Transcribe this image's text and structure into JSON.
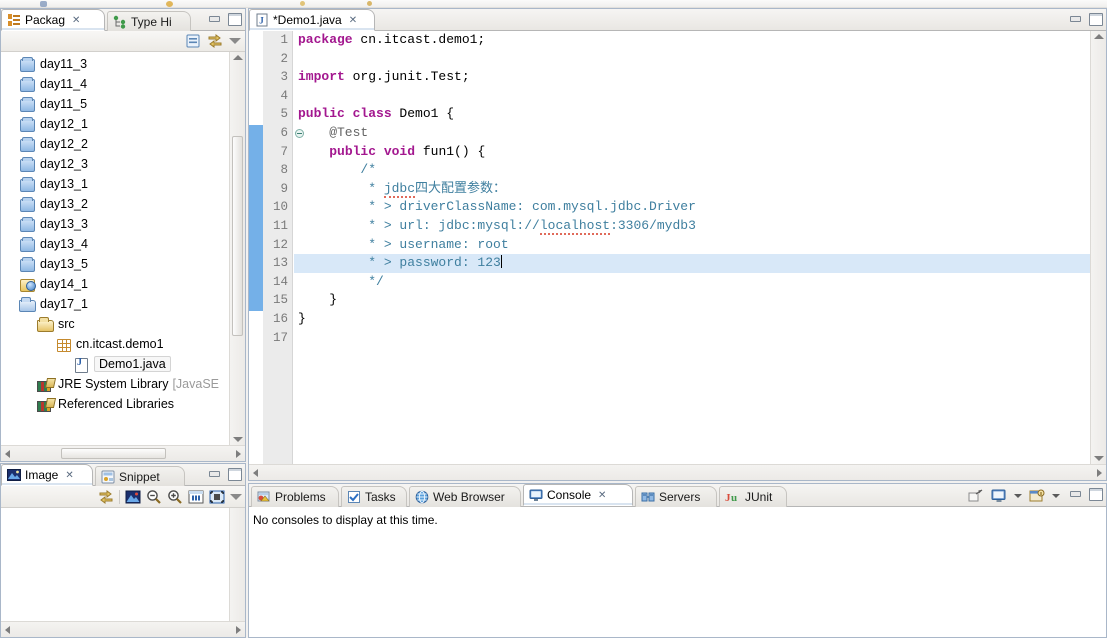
{
  "toolbar": {
    "dots": [
      "#7b93b8",
      "#d9a227",
      "#d9b34f",
      "#cfa23b"
    ]
  },
  "package_explorer": {
    "tabs": [
      {
        "label": "Packag",
        "icon": "package-explorer-icon",
        "active": true,
        "closable": true
      },
      {
        "label": "Type Hi",
        "icon": "type-hierarchy-icon",
        "active": false,
        "closable": false
      }
    ],
    "toolbar_icons": [
      "collapse-all-icon",
      "link-with-editor-icon",
      "view-menu-icon"
    ],
    "window_buttons": [
      "minimize",
      "maximize"
    ],
    "tree": [
      {
        "label": "day11_3",
        "icon": "project",
        "indent": 0,
        "selected": false
      },
      {
        "label": "day11_4",
        "icon": "project",
        "indent": 0,
        "selected": false
      },
      {
        "label": "day11_5",
        "icon": "project",
        "indent": 0,
        "selected": false
      },
      {
        "label": "day12_1",
        "icon": "project",
        "indent": 0,
        "selected": false
      },
      {
        "label": "day12_2",
        "icon": "project",
        "indent": 0,
        "selected": false
      },
      {
        "label": "day12_3",
        "icon": "project",
        "indent": 0,
        "selected": false
      },
      {
        "label": "day13_1",
        "icon": "project",
        "indent": 0,
        "selected": false
      },
      {
        "label": "day13_2",
        "icon": "project",
        "indent": 0,
        "selected": false
      },
      {
        "label": "day13_3",
        "icon": "project",
        "indent": 0,
        "selected": false
      },
      {
        "label": "day13_4",
        "icon": "project",
        "indent": 0,
        "selected": false
      },
      {
        "label": "day13_5",
        "icon": "project",
        "indent": 0,
        "selected": false
      },
      {
        "label": "day14_1",
        "icon": "project-web",
        "indent": 0,
        "selected": false
      },
      {
        "label": "day17_1",
        "icon": "project-open",
        "indent": 0,
        "selected": false
      },
      {
        "label": "src",
        "icon": "source-folder",
        "indent": 1,
        "selected": false
      },
      {
        "label": "cn.itcast.demo1",
        "icon": "package",
        "indent": 2,
        "selected": false
      },
      {
        "label": "Demo1.java",
        "icon": "java-file",
        "indent": 3,
        "selected": true
      },
      {
        "label": "JRE System Library",
        "suffix": "[JavaSE",
        "icon": "library",
        "indent": 1,
        "selected": false
      },
      {
        "label": "Referenced Libraries",
        "icon": "library",
        "indent": 1,
        "selected": false
      }
    ]
  },
  "image_view": {
    "tabs": [
      {
        "label": "Image",
        "icon": "image-icon",
        "active": true,
        "closable": true
      },
      {
        "label": "Snippet",
        "icon": "snippet-icon",
        "active": false,
        "closable": false
      }
    ],
    "toolbar_icons": [
      "refresh-icon",
      "image-icon",
      "zoom-out-icon",
      "zoom-in-icon",
      "fit-width-icon",
      "fit-page-icon",
      "view-menu-icon"
    ],
    "window_buttons": [
      "minimize",
      "maximize"
    ]
  },
  "editor": {
    "tab": {
      "label": "*Demo1.java",
      "icon": "java-file-icon",
      "closable": true,
      "dirty": true
    },
    "window_buttons": [
      "minimize",
      "maximize"
    ],
    "current_line": 13,
    "fold_marker_line": 6,
    "block_indicator": {
      "from_line": 6,
      "to_line": 15
    },
    "lines": [
      {
        "n": 1,
        "tokens": [
          {
            "t": "package",
            "c": "kw"
          },
          {
            "t": " cn.itcast.demo1;",
            "c": ""
          }
        ]
      },
      {
        "n": 2,
        "tokens": []
      },
      {
        "n": 3,
        "tokens": [
          {
            "t": "import",
            "c": "kw"
          },
          {
            "t": " org.junit.Test;",
            "c": ""
          }
        ]
      },
      {
        "n": 4,
        "tokens": []
      },
      {
        "n": 5,
        "tokens": [
          {
            "t": "public class",
            "c": "kw"
          },
          {
            "t": " Demo1 {",
            "c": ""
          }
        ]
      },
      {
        "n": 6,
        "tokens": [
          {
            "t": "    @Test",
            "c": "ann"
          }
        ]
      },
      {
        "n": 7,
        "tokens": [
          {
            "t": "    ",
            "c": ""
          },
          {
            "t": "public void",
            "c": "kw"
          },
          {
            "t": " fun1() {",
            "c": ""
          }
        ]
      },
      {
        "n": 8,
        "tokens": [
          {
            "t": "        /*",
            "c": "cm"
          }
        ]
      },
      {
        "n": 9,
        "tokens": [
          {
            "t": "         * ",
            "c": "cm"
          },
          {
            "t": "jdbc",
            "c": "cm-sq"
          },
          {
            "t": "四大配置参数：",
            "c": "cm"
          }
        ]
      },
      {
        "n": 10,
        "tokens": [
          {
            "t": "         * > driverClassName: com.mysql.jdbc.Driver",
            "c": "cm"
          }
        ]
      },
      {
        "n": 11,
        "tokens": [
          {
            "t": "         * > url: jdbc:mysql://",
            "c": "cm"
          },
          {
            "t": "localhost",
            "c": "cm-sq"
          },
          {
            "t": ":3306/mydb3",
            "c": "cm"
          }
        ]
      },
      {
        "n": 12,
        "tokens": [
          {
            "t": "         * > username: root",
            "c": "cm"
          }
        ]
      },
      {
        "n": 13,
        "tokens": [
          {
            "t": "         * > password: 123",
            "c": "cm"
          }
        ],
        "caret": true
      },
      {
        "n": 14,
        "tokens": [
          {
            "t": "         */",
            "c": "cm"
          }
        ]
      },
      {
        "n": 15,
        "tokens": [
          {
            "t": "    }",
            "c": ""
          }
        ]
      },
      {
        "n": 16,
        "tokens": [
          {
            "t": "}",
            "c": ""
          }
        ]
      },
      {
        "n": 17,
        "tokens": []
      }
    ]
  },
  "console_panel": {
    "tabs": [
      {
        "label": "Problems",
        "icon": "problems-icon",
        "active": false,
        "closable": false
      },
      {
        "label": "Tasks",
        "icon": "tasks-icon",
        "active": false,
        "closable": false
      },
      {
        "label": "Web Browser",
        "icon": "web-browser-icon",
        "active": false,
        "closable": false
      },
      {
        "label": "Console",
        "icon": "console-icon",
        "active": true,
        "closable": true
      },
      {
        "label": "Servers",
        "icon": "servers-icon",
        "active": false,
        "closable": false
      },
      {
        "label": "JUnit",
        "icon": "junit-icon",
        "active": false,
        "closable": false
      }
    ],
    "toolbar_icons": [
      "open-console-icon",
      "display-selected-console-icon",
      "console-dropdown-icon",
      "new-console-view-icon",
      "new-console-dropdown-icon"
    ],
    "window_buttons": [
      "minimize",
      "maximize"
    ],
    "message": "No consoles to display at this time."
  },
  "colors": {
    "keyword": "#a3178f",
    "comment": "#3f7f9f",
    "annotation": "#646464",
    "current_line": "#d8e8f8",
    "block_indicator": "#74b0e8",
    "panel_border": "#a9b7c9"
  }
}
